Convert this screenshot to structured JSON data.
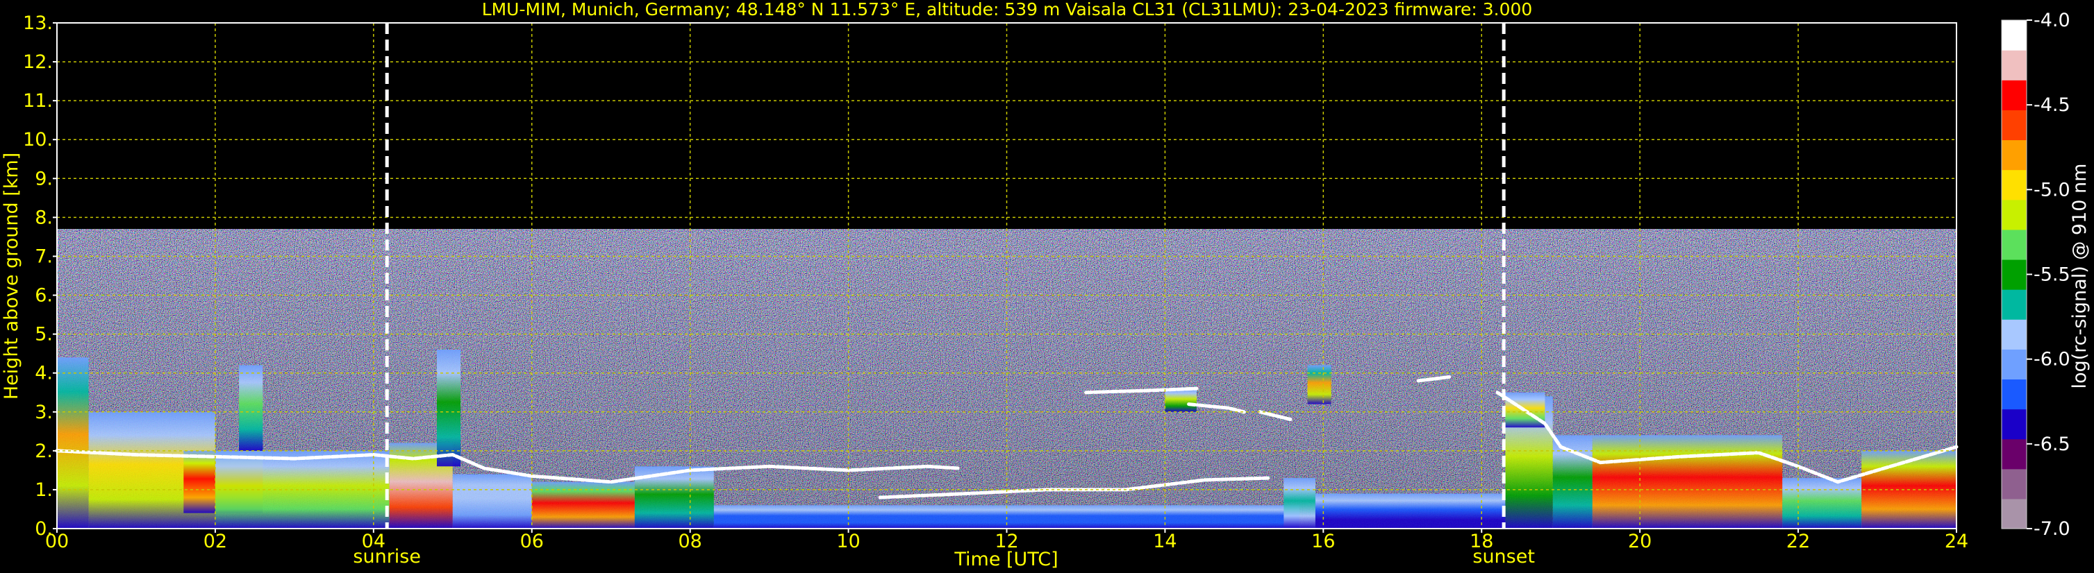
{
  "chart_data": {
    "type": "heatmap",
    "title": "LMU-MIM, Munich, Germany; 48.148° N 11.573° E, altitude: 539 m    Vaisala CL31 (CL31LMU): 23-04-2023    firmware: 3.000",
    "xlabel": "Time [UTC]",
    "ylabel": "Height above ground [km]",
    "xlim": [
      0,
      24
    ],
    "ylim": [
      0,
      13
    ],
    "x_ticks": [
      "00",
      "02",
      "04",
      "06",
      "08",
      "10",
      "12",
      "14",
      "16",
      "18",
      "20",
      "22",
      "24"
    ],
    "y_ticks": [
      "0.",
      "1.",
      "2.",
      "3.",
      "4.",
      "5.",
      "6.",
      "7.",
      "8.",
      "9.",
      "10.",
      "11.",
      "12.",
      "13."
    ],
    "grid": true,
    "colorbar": {
      "label": "log(rc-signal) @ 910 nm",
      "range": [
        -7.0,
        -4.0
      ],
      "ticks": [
        "-4.0",
        "-4.5",
        "-5.0",
        "-5.5",
        "-6.0",
        "-6.5",
        "-7.0"
      ],
      "colors": [
        "#a993a9",
        "#8f608f",
        "#6a006a",
        "#1a00c8",
        "#1a5aff",
        "#6fa0ff",
        "#a8c8ff",
        "#00b8a0",
        "#00a000",
        "#5ce05c",
        "#c8f000",
        "#ffe000",
        "#ffa000",
        "#ff4000",
        "#ff0000",
        "#f0c0c0",
        "#ffffff"
      ]
    },
    "sunrise": {
      "x": 4.17,
      "label": "sunrise"
    },
    "sunset": {
      "x": 18.28,
      "label": "sunset"
    },
    "noise_top_km": 7.7,
    "layers": [
      {
        "x0": 0.0,
        "x1": 0.4,
        "y0": 0.0,
        "y1": 4.4,
        "level": 0.75
      },
      {
        "x0": 0.4,
        "x1": 2.0,
        "y0": 0.0,
        "y1": 3.0,
        "level": 0.7
      },
      {
        "x0": 1.6,
        "x1": 2.6,
        "y0": 0.4,
        "y1": 2.0,
        "level": 0.9
      },
      {
        "x0": 2.0,
        "x1": 4.2,
        "y0": 0.0,
        "y1": 2.0,
        "level": 0.65
      },
      {
        "x0": 2.3,
        "x1": 2.6,
        "y0": 2.0,
        "y1": 4.2,
        "level": 0.55
      },
      {
        "x0": 4.2,
        "x1": 5.0,
        "y0": 0.0,
        "y1": 2.2,
        "level": 0.95
      },
      {
        "x0": 4.8,
        "x1": 5.1,
        "y0": 1.6,
        "y1": 4.6,
        "level": 0.5
      },
      {
        "x0": 5.0,
        "x1": 6.0,
        "y0": 0.0,
        "y1": 1.4,
        "level": 0.4
      },
      {
        "x0": 6.0,
        "x1": 7.3,
        "y0": 0.0,
        "y1": 1.2,
        "level": 0.85
      },
      {
        "x0": 7.3,
        "x1": 8.3,
        "y0": 0.0,
        "y1": 1.6,
        "level": 0.5
      },
      {
        "x0": 8.3,
        "x1": 15.7,
        "y0": 0.0,
        "y1": 0.6,
        "level": 0.28
      },
      {
        "x0": 15.5,
        "x1": 15.9,
        "y0": 0.0,
        "y1": 1.3,
        "level": 0.45
      },
      {
        "x0": 15.9,
        "x1": 18.3,
        "y0": 0.0,
        "y1": 0.9,
        "level": 0.25
      },
      {
        "x0": 18.3,
        "x1": 18.9,
        "y0": 0.0,
        "y1": 3.4,
        "level": 0.62
      },
      {
        "x0": 18.9,
        "x1": 19.4,
        "y0": 0.0,
        "y1": 2.4,
        "level": 0.5
      },
      {
        "x0": 19.4,
        "x1": 21.8,
        "y0": 0.0,
        "y1": 2.4,
        "level": 0.9
      },
      {
        "x0": 21.8,
        "x1": 22.8,
        "y0": 0.0,
        "y1": 1.3,
        "level": 0.55
      },
      {
        "x0": 22.8,
        "x1": 24.0,
        "y0": 0.0,
        "y1": 2.0,
        "level": 0.9
      },
      {
        "x0": 15.8,
        "x1": 16.1,
        "y0": 3.2,
        "y1": 4.2,
        "level": 0.72
      },
      {
        "x0": 14.0,
        "x1": 14.4,
        "y0": 3.0,
        "y1": 3.6,
        "level": 0.6
      },
      {
        "x0": 18.3,
        "x1": 18.8,
        "y0": 2.6,
        "y1": 3.5,
        "level": 0.66
      }
    ],
    "cloud_bases": [
      [
        [
          0.0,
          2.0
        ],
        [
          1.0,
          1.9
        ],
        [
          2.0,
          1.85
        ],
        [
          3.0,
          1.8
        ],
        [
          4.0,
          1.9
        ],
        [
          4.5,
          1.8
        ],
        [
          5.0,
          1.9
        ],
        [
          5.4,
          1.55
        ],
        [
          6.0,
          1.35
        ],
        [
          7.0,
          1.2
        ],
        [
          8.0,
          1.5
        ],
        [
          9.0,
          1.6
        ],
        [
          10.0,
          1.5
        ],
        [
          11.0,
          1.6
        ],
        [
          11.4,
          1.55
        ]
      ],
      [
        [
          10.4,
          0.8
        ],
        [
          11.5,
          0.9
        ],
        [
          12.5,
          1.0
        ],
        [
          13.5,
          1.0
        ],
        [
          14.5,
          1.25
        ],
        [
          15.3,
          1.3
        ]
      ],
      [
        [
          13.0,
          3.5
        ],
        [
          13.8,
          3.55
        ],
        [
          14.4,
          3.6
        ]
      ],
      [
        [
          14.3,
          3.2
        ],
        [
          14.8,
          3.1
        ],
        [
          15.0,
          3.0
        ]
      ],
      [
        [
          15.2,
          3.0
        ],
        [
          15.6,
          2.8
        ]
      ],
      [
        [
          17.2,
          3.8
        ],
        [
          17.6,
          3.9
        ]
      ],
      [
        [
          18.2,
          3.5
        ],
        [
          18.8,
          2.7
        ],
        [
          19.0,
          2.1
        ],
        [
          19.5,
          1.7
        ],
        [
          20.5,
          1.85
        ],
        [
          21.5,
          1.95
        ],
        [
          22.0,
          1.6
        ],
        [
          22.5,
          1.2
        ],
        [
          23.0,
          1.5
        ],
        [
          23.5,
          1.8
        ],
        [
          24.0,
          2.1
        ]
      ]
    ]
  }
}
